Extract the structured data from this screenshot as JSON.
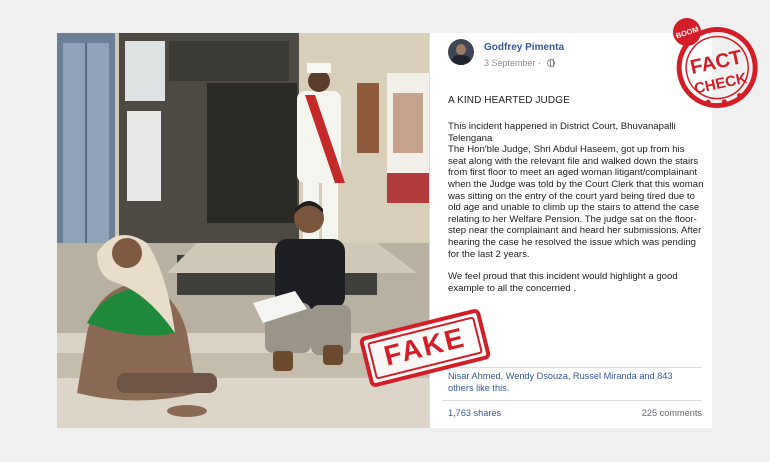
{
  "post": {
    "author": "Godfrey Pimenta",
    "date": "3 September",
    "date_separator": " · ",
    "title": "A KIND HEARTED JUDGE",
    "body": "This incident happened in District Court, Bhuvanapalli Telengana\nThe Hon'ble Judge, Shri Abdul Haseem, got up from his seat along with the relevant file and walked down the stairs from first floor to meet an aged woman litigant/complainant when the Judge was told by the Court Clerk that this woman was sitting on the entry of the court yard being tired due to old age and unable to climb up the stairs to attend the case relating to her Welfare Pension. The judge sat on the floor-step near the complainant and heard her submissions. After hearing the case he resolved the issue which was pending for the last 2 years.",
    "closing": "We feel proud that this incident would highlight a good example to all the concerned .",
    "likes": "Nisar Ahmed, Wendy Dsouza, Russel Miranda and 843 others like this.",
    "shares": "1,763 shares",
    "comments": "225 comments"
  },
  "stamps": {
    "fake": "FAKE",
    "fact_check_top": "BOOM",
    "fact_check_line1": "FACT",
    "fact_check_line2": "CHECK"
  },
  "colors": {
    "stamp_red": "#d31e28",
    "link_blue": "#385898",
    "muted_grey": "#8a8d91"
  },
  "icons": {
    "privacy": "globe-icon"
  }
}
